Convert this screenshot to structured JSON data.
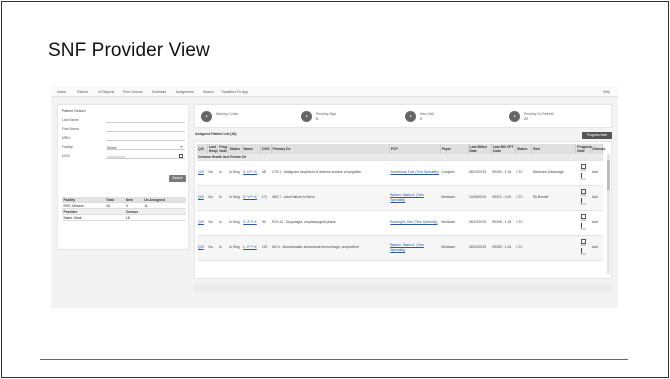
{
  "slide": {
    "title": "SNF Provider View"
  },
  "nav": {
    "items": [
      "Home",
      "Patient",
      "UI Reports",
      "Print Census",
      "Schedule",
      "Assignment",
      "Search",
      "Transition FU App"
    ],
    "help": "Help"
  },
  "patient_search": {
    "title": "Patient Search",
    "fields": [
      {
        "label": "Last Name:"
      },
      {
        "label": "First Name:"
      },
      {
        "label": "MRN:"
      },
      {
        "label": "Facility:",
        "value": "Select"
      },
      {
        "label": "DOS:",
        "placeholder": "mm/dd/yyyy"
      }
    ],
    "search_label": "Search"
  },
  "facility_table": {
    "headers": [
      "Facility",
      "Total",
      "New",
      "Un Assigned"
    ],
    "rows": [
      [
        "RHC Orleans",
        "18",
        "0",
        "11"
      ]
    ],
    "sub_headers": [
      "Provider",
      "Census"
    ],
    "sub_rows": [
      [
        "Baker, Mark",
        "18"
      ]
    ]
  },
  "summary_cards": [
    {
      "label": "Missing Codes",
      "value": ""
    },
    {
      "label": "Pending Sign",
      "value": "5"
    },
    {
      "label": "New Visit",
      "value": "0"
    },
    {
      "label": "Pending Sx Refresh",
      "value": "20"
    }
  ],
  "list": {
    "title": "Assigned Patient List (18)",
    "progress_note_label": "Progress Note",
    "headers": [
      "Q/S",
      "Last Hosp",
      "Prog Note",
      "Status",
      "Name",
      "DOS",
      "Primary Dx",
      "PCP",
      "Payer",
      "Last Billed Date",
      "Last MD CPT Code",
      "Status",
      "Bed",
      "Progress Note",
      "Discuss"
    ],
    "group": "Orleans Health And Rehab Ctr",
    "rows": [
      {
        "c1": "Q/S",
        "c2": "No",
        "c3": "In",
        "c4": "In Mng",
        "name": "S. D***-K",
        "dos": "4B",
        "dx": "C78.1 - Malignant neoplasm of anterior surface of epiglottis",
        "pcp": "Somebody, Doe (Tres Specialty)",
        "payer": "Complex",
        "date": "08/19/2019",
        "cpt": "99309 - 1.15",
        "status": "LTC",
        "bed": "Medicare Advantage"
      },
      {
        "c1": "Q/S",
        "c2": "No",
        "c3": "In",
        "c4": "In Mng",
        "name": "S. V***-K",
        "dos": "171",
        "dx": "N62.7 - Adult failure to thrive",
        "pcp": "Baiden, Maria A. (Tres Specialty)",
        "payer": "Medicare",
        "date": "10/05/2019",
        "cpt": "99310 - 2.60",
        "status": "LTC",
        "bed": "PA Bundle"
      },
      {
        "c1": "Q/S",
        "c2": "No",
        "c3": "In",
        "c4": "In Mng",
        "name": "S. Z***-K",
        "dos": "36",
        "dx": "R13.12 - Dysphagia, oropharyngeal phase",
        "pcp": "Bonbright, Dan (Tres Specialty)",
        "payer": "Medicare",
        "date": "08/19/2019",
        "cpt": "99308 - 1.15",
        "status": "LTC",
        "bed": ""
      },
      {
        "c1": "Q/S",
        "c2": "No",
        "c3": "In",
        "c4": "In Mng",
        "name": "L. C***-K",
        "dos": "120",
        "dx": "I62.9 - Nontraumatic intracranial hemorrhage, unspecified",
        "pcp": "Baiden, Maria A. (Tres Specialty)",
        "payer": "Medicare",
        "date": "08/19/2019",
        "cpt": "99309 - 1.15",
        "status": "LTC",
        "bed": ""
      }
    ],
    "action_labels": {
      "note": "Note",
      "print": "Print",
      "discuss": "Add"
    }
  }
}
